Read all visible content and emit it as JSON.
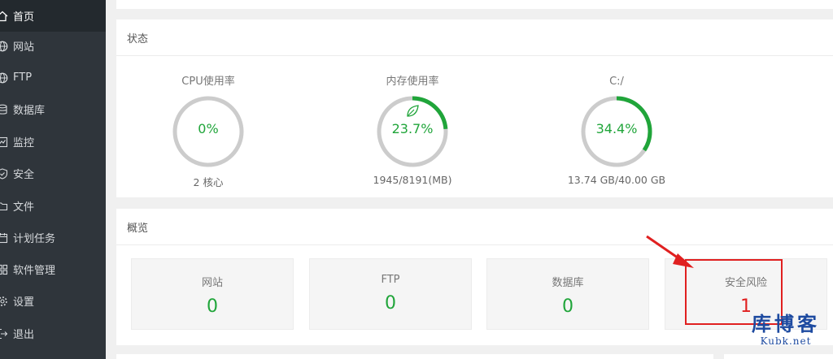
{
  "sidebar": {
    "items": [
      {
        "label": "首页",
        "icon": "home-icon",
        "active": true
      },
      {
        "label": "网站",
        "icon": "globe-icon"
      },
      {
        "label": "FTP",
        "icon": "globe-icon"
      },
      {
        "label": "数据库",
        "icon": "database-icon"
      },
      {
        "label": "监控",
        "icon": "monitor-icon"
      },
      {
        "label": "安全",
        "icon": "shield-icon"
      },
      {
        "label": "文件",
        "icon": "folder-icon"
      },
      {
        "label": "计划任务",
        "icon": "calendar-icon"
      },
      {
        "label": "软件管理",
        "icon": "apps-icon"
      },
      {
        "label": "设置",
        "icon": "gear-icon"
      },
      {
        "label": "退出",
        "icon": "logout-icon"
      }
    ]
  },
  "status": {
    "title": "状态",
    "gauges": [
      {
        "title": "CPU使用率",
        "value": "0%",
        "sub": "2 核心",
        "percent": 0
      },
      {
        "title": "内存使用率",
        "value": "23.7%",
        "sub": "1945/8191(MB)",
        "percent": 23.7,
        "icon": "leaf-icon"
      },
      {
        "title": "C:/",
        "value": "34.4%",
        "sub": "13.74 GB/40.00 GB",
        "percent": 34.4
      }
    ]
  },
  "overview": {
    "title": "概览",
    "boxes": [
      {
        "label": "网站",
        "value": "0"
      },
      {
        "label": "FTP",
        "value": "0"
      },
      {
        "label": "数据库",
        "value": "0"
      },
      {
        "label": "安全风险",
        "value": "1",
        "status": "warning"
      }
    ]
  },
  "watermark": {
    "title": "库博客",
    "url": "Kubk.net"
  },
  "colors": {
    "accent": "#20a53a",
    "warning": "#e02020",
    "sidebar": "#2f353b",
    "ring_track": "#cccccc"
  }
}
